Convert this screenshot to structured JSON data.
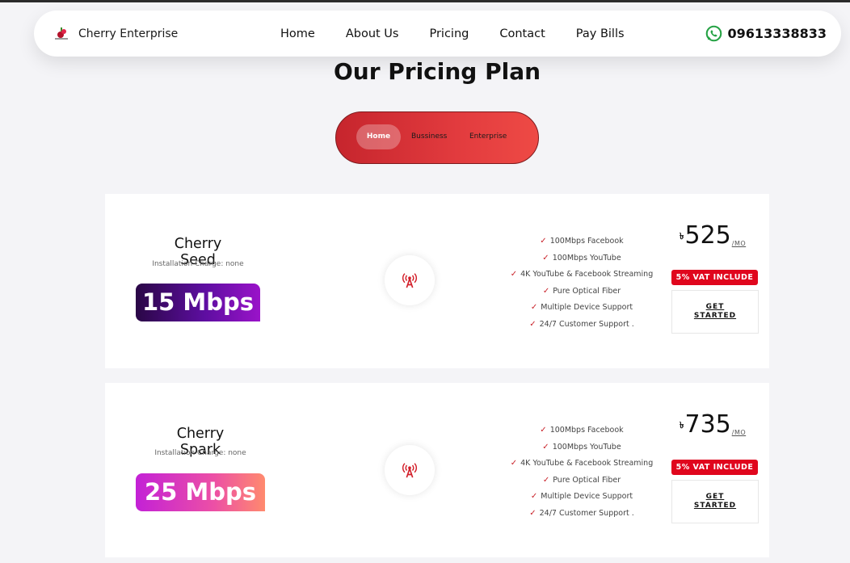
{
  "navbar": {
    "brand": "Cherry Enterprise",
    "links": [
      "Home",
      "About Us",
      "Pricing",
      "Contact",
      "Pay Bills"
    ],
    "phone": "09613338833"
  },
  "page_title": "Our Pricing Plan",
  "tabs": [
    "Home",
    "Bussiness",
    "Enterprise"
  ],
  "active_tab": "Home",
  "plans": [
    {
      "name": "Cherry Seed",
      "installation": "Installation Charge: none",
      "speed": "15 Mbps",
      "features": [
        "100Mbps Facebook",
        "100Mbps YouTube",
        "4K YouTube & Facebook Streaming",
        "Pure Optical Fiber",
        "Multiple Device Support",
        "24/7 Customer Support ."
      ],
      "currency": "৳",
      "price": "525",
      "per": "/MO",
      "vat": "5% VAT INCLUDE",
      "cta": "GET STARTED"
    },
    {
      "name": "Cherry Spark",
      "installation": "Installation Charge: none",
      "speed": "25 Mbps",
      "features": [
        "100Mbps Facebook",
        "100Mbps YouTube",
        "4K YouTube & Facebook Streaming",
        "Pure Optical Fiber",
        "Multiple Device Support",
        "24/7 Customer Support ."
      ],
      "currency": "৳",
      "price": "735",
      "per": "/MO",
      "vat": "5% VAT INCLUDE",
      "cta": "GET STARTED"
    }
  ],
  "colors": {
    "accent_red": "#e0061d",
    "check_red": "#c9222a",
    "tab_gradient_start": "#c6252d",
    "tab_gradient_end": "#ee4a45",
    "whatsapp_green": "#25a244"
  },
  "icons": {
    "whatsapp": "whatsapp-icon",
    "tower": "signal-tower-icon",
    "check": "check-icon"
  }
}
